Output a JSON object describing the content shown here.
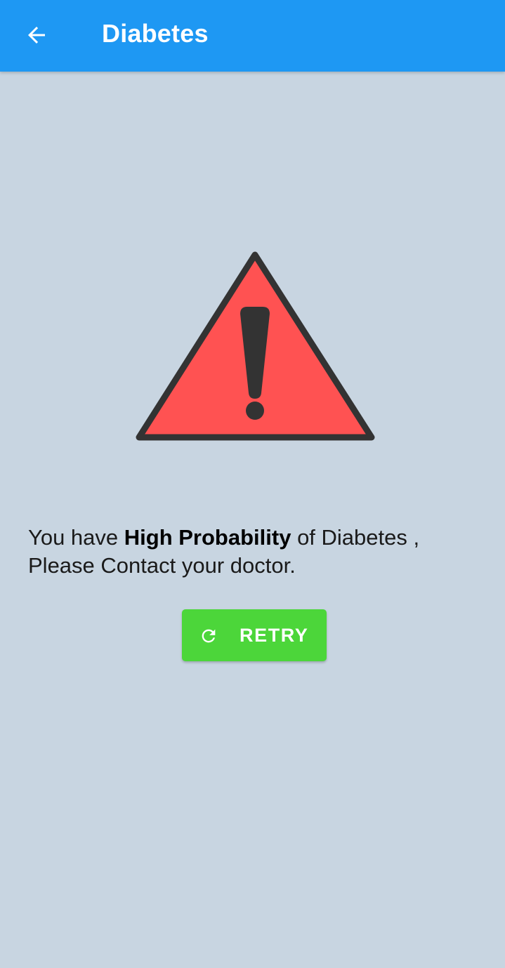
{
  "app_bar": {
    "title": "Diabetes",
    "back_icon": "arrow-back-icon",
    "background_color": "#1e98f3"
  },
  "result": {
    "icon": "warning-icon",
    "icon_color": "#ff5252",
    "message_prefix": "You have ",
    "message_emphasis": "High Probability",
    "message_suffix": " of Diabetes , Please Contact your doctor."
  },
  "retry_button": {
    "label": "RETRY",
    "icon": "refresh-icon",
    "color": "#4cd63a"
  }
}
